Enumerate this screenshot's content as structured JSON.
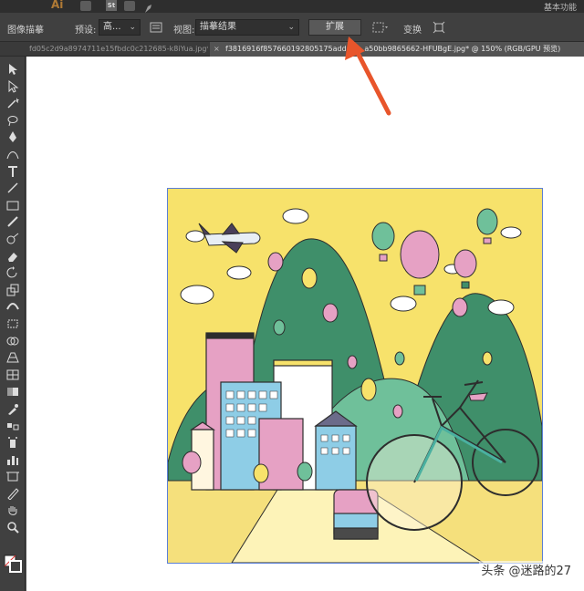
{
  "menubar": {
    "app_logo": "Ai",
    "st_label": "St",
    "workspace": "基本功能"
  },
  "control_bar": {
    "panel_label": "图像描摹",
    "preset_label": "预设:",
    "preset_value": "高...",
    "view_label": "视图:",
    "view_value": "描摹结果",
    "expand_button": "扩展",
    "transform_label": "变换"
  },
  "tabs": [
    {
      "label": "fd05c2d9a8974711e15fbdc0c212685-k8iYua.jpg*",
      "active": false
    },
    {
      "label": "f3816916f857660192805175addc6... a50bb9865662-HFUBgE.jpg* @ 150% (RGB/GPU 预览)",
      "active": true
    }
  ],
  "tools": [
    "selection-tool",
    "direct-selection-tool",
    "magic-wand-tool",
    "lasso-tool",
    "pen-tool",
    "curvature-tool",
    "type-tool",
    "line-tool",
    "rectangle-tool",
    "paintbrush-tool",
    "shaper-tool",
    "eraser-tool",
    "rotate-tool",
    "scale-tool",
    "width-tool",
    "free-transform-tool",
    "shape-builder-tool",
    "perspective-grid-tool",
    "mesh-tool",
    "gradient-tool",
    "eyedropper-tool",
    "blend-tool",
    "symbol-sprayer-tool",
    "column-graph-tool",
    "artboard-tool",
    "slice-tool",
    "hand-tool",
    "zoom-tool"
  ],
  "colors": {
    "artwork_bg": "#f7e26b",
    "mountain_dark": "#3f8f6a",
    "mountain_light": "#6fc09a",
    "building_pink": "#e6a1c4",
    "building_blue": "#8ecde6",
    "arrow": "#e8552b",
    "selection": "#5b7fd6"
  },
  "watermark": "头条 @迷路的27"
}
